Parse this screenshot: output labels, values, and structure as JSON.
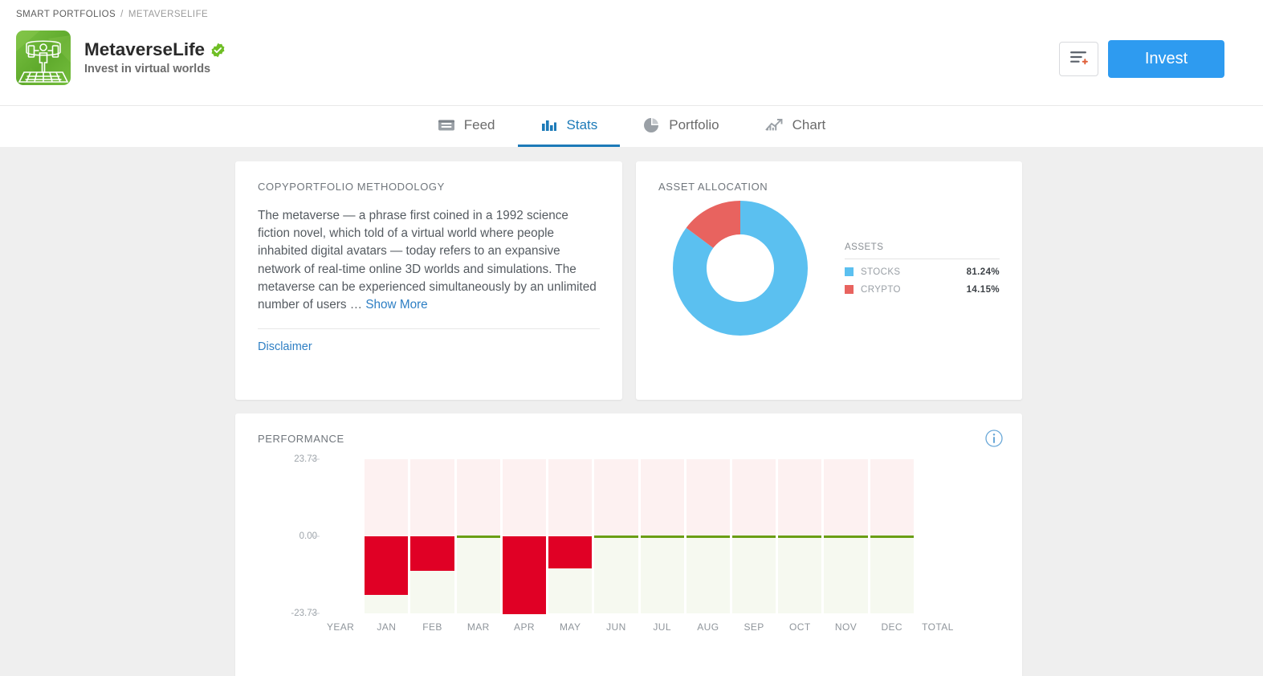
{
  "breadcrumb": {
    "root": "SMART PORTFOLIOS",
    "separator": "/",
    "current": "METAVERSELIFE"
  },
  "identity": {
    "title": "MetaverseLife",
    "subtitle": "Invest in virtual worlds",
    "verified_icon": "verified-badge-icon",
    "logo_icon": "metaverse-portfolio-logo"
  },
  "header_actions": {
    "watchlist_icon": "add-to-watchlist-icon",
    "invest_label": "Invest"
  },
  "tabs": [
    {
      "label": "Feed",
      "icon": "feed-icon",
      "active": false
    },
    {
      "label": "Stats",
      "icon": "bar-chart-icon",
      "active": true
    },
    {
      "label": "Portfolio",
      "icon": "pie-chart-icon",
      "active": false
    },
    {
      "label": "Chart",
      "icon": "trend-chart-icon",
      "active": false
    }
  ],
  "methodology": {
    "title": "COPYPORTFOLIO METHODOLOGY",
    "body": "The metaverse — a phrase first coined in a 1992 science fiction novel, which told of a virtual world where people inhabited digital avatars — today refers to an expansive network of real-time online 3D worlds and simulations. The metaverse can be experienced simultaneously by an unlimited number of users",
    "ellipsis": "…",
    "show_more": "Show More",
    "disclaimer": "Disclaimer"
  },
  "allocation": {
    "title": "ASSET ALLOCATION",
    "legend_header": "ASSETS",
    "items": [
      {
        "label": "STOCKS",
        "value": "81.24%",
        "color": "#5bc0f0",
        "pct": 81.24
      },
      {
        "label": "CRYPTO",
        "value": "14.15%",
        "color": "#e8635f",
        "pct": 14.15
      }
    ]
  },
  "performance": {
    "title": "PERFORMANCE",
    "info_icon": "info-icon"
  },
  "chart_data": {
    "type": "bar",
    "title": "PERFORMANCE",
    "xlabel": "",
    "ylabel": "",
    "categories": [
      "YEAR",
      "JAN",
      "FEB",
      "MAR",
      "APR",
      "MAY",
      "JUN",
      "JUL",
      "AUG",
      "SEP",
      "OCT",
      "NOV",
      "DEC",
      "TOTAL"
    ],
    "values": [
      null,
      -18.0,
      -10.7,
      0.0,
      -24.0,
      -9.9,
      0.0,
      0.0,
      0.0,
      0.0,
      0.0,
      0.0,
      0.0,
      null
    ],
    "ytick_labels": [
      "23.73",
      "0.00",
      "-23.73"
    ],
    "ytick_values": [
      23.73,
      0.0,
      -23.73
    ],
    "ylim": [
      -23.73,
      23.73
    ],
    "grid": false,
    "legend": "none",
    "positive_color": "#6fa51e",
    "negative_color": "#e00025",
    "positive_band_color": "#fdf1f1",
    "negative_band_color": "#f6f9f0",
    "zero_line_color": "#6a9e15"
  },
  "colors": {
    "accent_blue": "#2e9bf0",
    "tab_active": "#1c7ab8",
    "brand_green": "#7ac143",
    "page_bg": "#efefef"
  }
}
